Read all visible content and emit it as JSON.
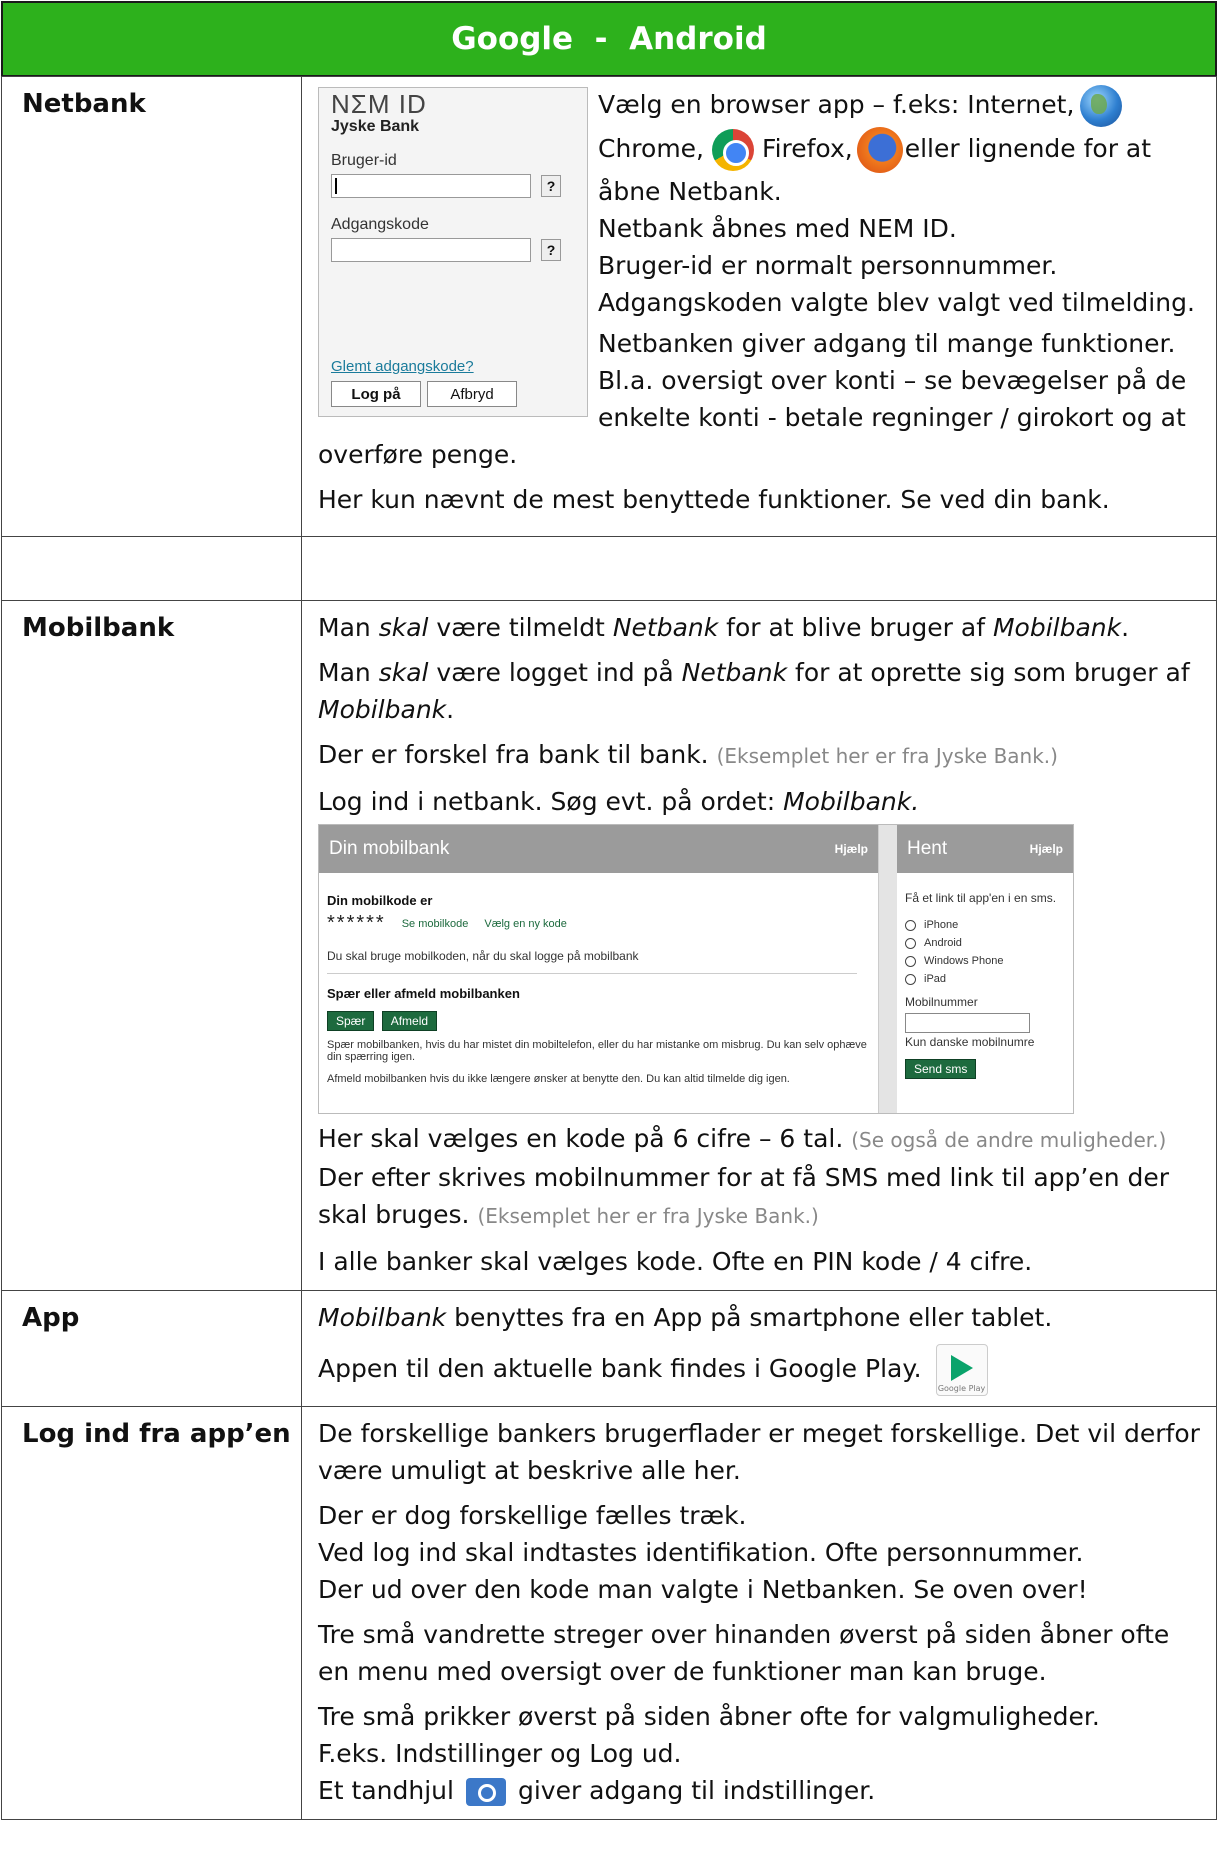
{
  "header": {
    "title": "Google  -  Android"
  },
  "netbank": {
    "label": "Netbank",
    "nemid": {
      "logo": "NΣM ID",
      "bank": "Jyske Bank",
      "user_label": "Bruger-id",
      "password_label": "Adgangskode",
      "help": "?",
      "forgot": "Glemt adgangskode?",
      "login": "Log på",
      "cancel": "Afbryd"
    },
    "line1": "Vælg en browser app – f.eks: Internet,",
    "line2a": "Chrome,",
    "line2b": "Firefox,",
    "line2c": "eller lignende for at",
    "line3": "åbne Netbank.",
    "line4": "Netbank åbnes med NEM ID.",
    "line5": "Bruger-id er normalt personnummer.",
    "line6": "Adgangskoden valgte blev valgt ved tilmelding.",
    "line7": "Netbanken giver adgang til mange funktioner.",
    "line8": "Bl.a. oversigt over konti – se bevægelser på de enkelte konti - betale regninger / girokort og at overføre penge.",
    "line9": "Her kun nævnt de mest benyttede funktioner. Se ved din bank."
  },
  "mobilbank": {
    "label": "Mobilbank",
    "p1": {
      "a": "Man ",
      "b": "skal",
      "c": " være tilmeldt ",
      "d": "Netbank",
      "e": " for at blive bruger af ",
      "f": "Mobilbank",
      "g": "."
    },
    "p2": {
      "a": "Man ",
      "b": "skal",
      "c": " være logget ind på ",
      "d": "Netbank",
      "e": " for at oprette sig som bruger af ",
      "f": "Mobilbank",
      "g": "."
    },
    "p3": "Der er forskel fra bank til bank.",
    "p3_note": "(Eksemplet her er fra Jyske Bank.)",
    "p4": "Log ind i netbank. Søg evt. på ordet: ",
    "p4_italic": "Mobilbank.",
    "screen": {
      "title": "Din mobilbank",
      "help": "Hjælp",
      "code_heading": "Din mobilkode er",
      "stars": "******",
      "see_code": "Se mobilkode",
      "new_code": "Vælg en ny kode",
      "use_text": "Du skal bruge mobilkoden, når du skal logge på mobilbank",
      "block_heading": "Spær eller afmeld mobilbanken",
      "block_btn": "Spær",
      "unsub_btn": "Afmeld",
      "block_text": "Spær mobilbanken, hvis du har mistet din mobiltelefon, eller du har mistanke om misbrug. Du kan selv ophæve din spærring igen.",
      "unsub_text": "Afmeld mobilbanken hvis du ikke længere ønsker at benytte den. Du kan altid tilmelde dig igen.",
      "right_title": "Hent",
      "right_help": "Hjælp",
      "link_text": "Få et link til app'en i en sms.",
      "options": [
        "iPhone",
        "Android",
        "Windows Phone",
        "iPad"
      ],
      "mobile_label": "Mobilnummer",
      "mobile_hint": "Kun danske mobilnumre",
      "send": "Send sms"
    },
    "p5": "Her skal vælges en kode på 6 cifre – 6 tal.",
    "p5_note": "(Se også de andre muligheder.)",
    "p6": "Der efter skrives mobilnummer for at få SMS med link til app’en der skal bruges.",
    "p6_note": "(Eksemplet her er fra Jyske Bank.)",
    "p7": "I alle banker skal vælges kode. Ofte en PIN kode / 4 cifre."
  },
  "app": {
    "label": "App",
    "p1_italic": "Mobilbank",
    "p1": " benyttes fra en App på smartphone eller tablet.",
    "p2": "Appen til den aktuelle bank findes i Google Play.",
    "play_label": "Google Play"
  },
  "login": {
    "label": "Log ind fra app’en",
    "p1": "De forskellige bankers brugerflader er meget forskellige. Det vil derfor være umuligt at beskrive alle her.",
    "p2a": "Der er dog forskellige fælles træk.",
    "p2b": "Ved log ind skal indtastes identifikation. Ofte personnummer.",
    "p2c": "Der ud over den kode man valgte i Netbanken. Se oven over!",
    "p3": "Tre små vandrette streger over hinanden øverst på siden åbner ofte en menu med oversigt over de funktioner man kan bruge.",
    "p4a": "Tre små prikker øverst på siden åbner ofte for valgmuligheder.",
    "p4b": "F.eks. Indstillinger og Log ud.",
    "p4c_a": "Et tandhjul",
    "p4c_b": "giver adgang til indstillinger."
  }
}
